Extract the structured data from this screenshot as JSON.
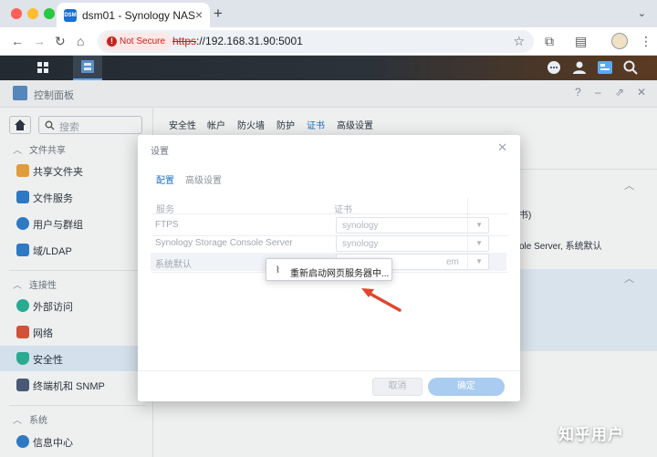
{
  "browser": {
    "tab_title": "dsm01 - Synology NAS",
    "tab_favicon_text": "DSM",
    "not_secure_label": "Not Secure",
    "url_protocol": "https",
    "url_rest": "://192.168.31.90:5001"
  },
  "window": {
    "title": "控制面板"
  },
  "sidebar": {
    "search_placeholder": "搜索",
    "sections": [
      {
        "label": "文件共享",
        "items": [
          {
            "label": "共享文件夹",
            "icon": "shared-folder-icon",
            "color": "#f0a43c"
          },
          {
            "label": "文件服务",
            "icon": "file-services-icon",
            "color": "#2f7fd1"
          },
          {
            "label": "用户与群组",
            "icon": "users-icon",
            "color": "#2f7fd1"
          },
          {
            "label": "域/LDAP",
            "icon": "domain-ldap-icon",
            "color": "#2f7fd1"
          }
        ]
      },
      {
        "label": "连接性",
        "items": [
          {
            "label": "外部访问",
            "icon": "external-access-icon",
            "color": "#2bb59a"
          },
          {
            "label": "网络",
            "icon": "network-icon",
            "color": "#e0553c"
          },
          {
            "label": "安全性",
            "icon": "security-shield-icon",
            "color": "#2bb59a"
          },
          {
            "label": "终端机和 SNMP",
            "icon": "terminal-icon",
            "color": "#4a5d7a"
          }
        ]
      },
      {
        "label": "系统",
        "items": [
          {
            "label": "信息中心",
            "icon": "info-center-icon",
            "color": "#2f7fd1"
          }
        ]
      }
    ],
    "active_item": "安全性"
  },
  "main": {
    "tabs": [
      "安全性",
      "帐户",
      "防火墙",
      "防护",
      "证书",
      "高级设置"
    ],
    "active_tab": "证书",
    "bg_text_1": "书)",
    "bg_text_2": "ole Server, 系统默认"
  },
  "modal": {
    "title": "设置",
    "tabs": [
      "配置",
      "高级设置"
    ],
    "active_tab": "配置",
    "columns": [
      "服务",
      "证书"
    ],
    "rows": [
      {
        "service": "FTPS",
        "certificate": "synology"
      },
      {
        "service": "Synology Storage Console Server",
        "certificate": "synology"
      },
      {
        "service": "系统默认",
        "certificate": "em"
      }
    ],
    "cancel_label": "取消",
    "ok_label": "确定"
  },
  "popup": {
    "text": "重新启动网页服务器中..."
  },
  "watermark": "知乎用户",
  "colors": {
    "accent": "#1a73c9",
    "arrow": "#e0472f",
    "active_nav_bg": "#e3effb"
  }
}
